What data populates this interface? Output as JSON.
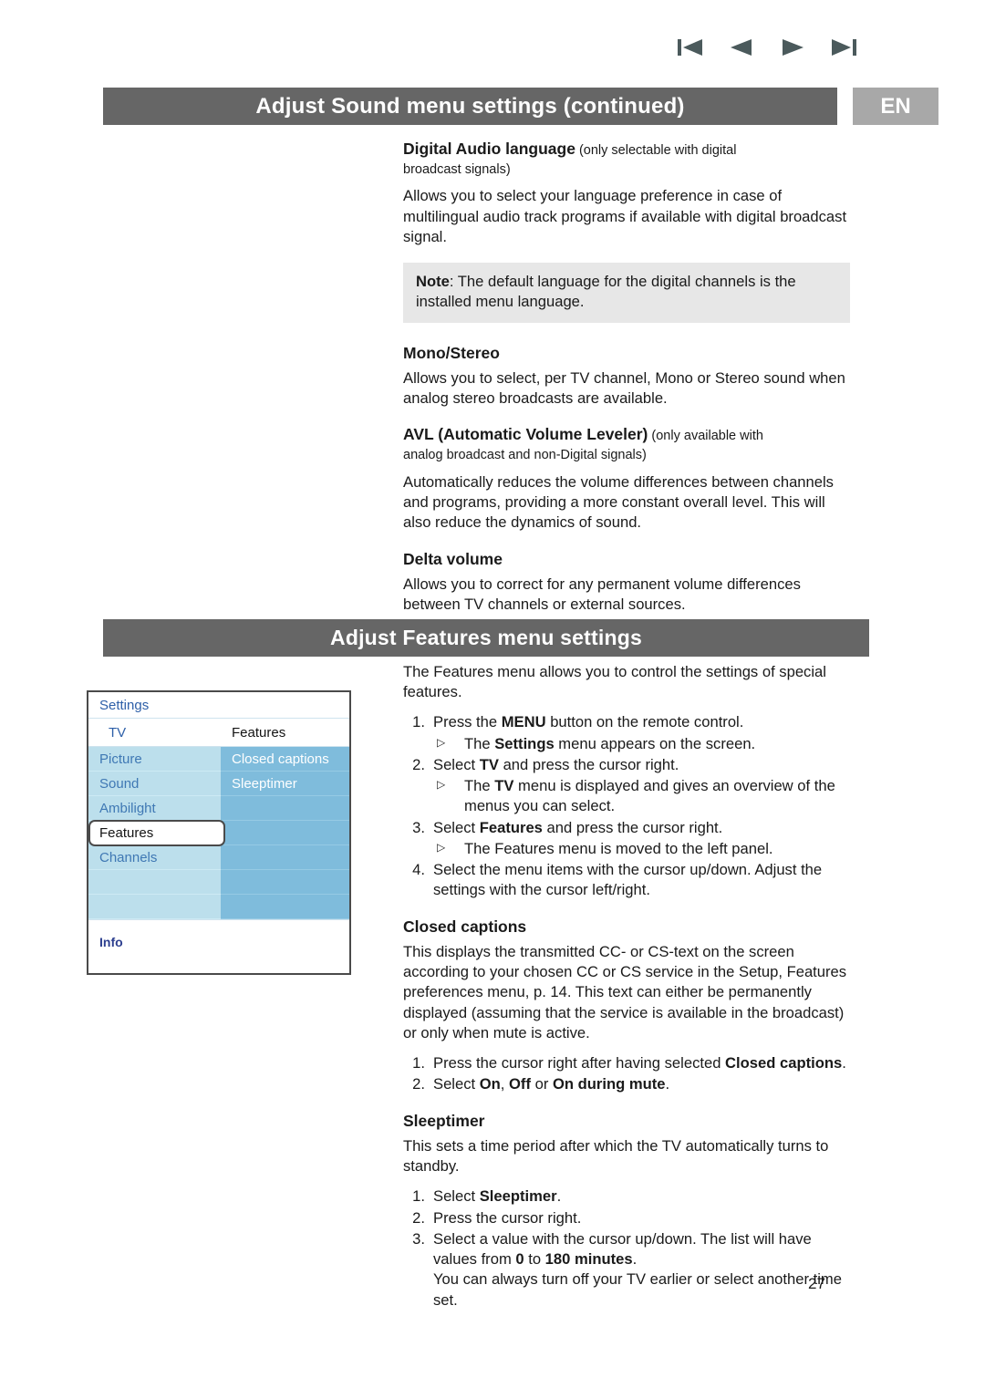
{
  "nav": {
    "first_label": "first-page",
    "prev_label": "previous-page",
    "next_label": "next-page",
    "last_label": "last-page"
  },
  "header": {
    "sound_title": "Adjust Sound menu settings  (continued)",
    "features_title": "Adjust Features menu settings",
    "language_badge": "EN",
    "bar_color": "#666666",
    "badge_color": "#a8a8a8"
  },
  "sound_section": {
    "digital_audio": {
      "heading_bold": "Digital Audio language",
      "heading_sub": " (only selectable with digital",
      "heading_sub_line2": "broadcast signals)",
      "body": "Allows you to select your language preference in case of multilingual audio track programs if available with digital broadcast signal."
    },
    "note": {
      "label": "Note",
      "text": ": The default language for the digital channels is the installed menu language.",
      "bg_color": "#e7e7e7"
    },
    "mono_stereo": {
      "heading": "Mono/Stereo",
      "body": "Allows you to select, per TV channel, Mono or Stereo sound when analog stereo broadcasts are available."
    },
    "avl": {
      "heading_bold": "AVL (Automatic Volume Leveler)",
      "heading_sub": " (only available with",
      "heading_sub_line2": "analog broadcast and non-Digital signals)",
      "body": "Automatically reduces the volume differences between channels and programs, providing a more constant overall level. This will also reduce the dynamics of sound."
    },
    "delta_volume": {
      "heading": "Delta volume",
      "body": "Allows you to correct for any permanent volume differences between TV channels or external sources."
    }
  },
  "tv_menu": {
    "title": "Settings",
    "left_header": "TV",
    "right_header": "Features",
    "left_items": [
      "Picture",
      "Sound",
      "Ambilight",
      "Features",
      "Channels"
    ],
    "selected_left_item": "Features",
    "right_items": [
      "Closed captions",
      "Sleeptimer"
    ],
    "footer": "Info",
    "left_bg_color": "#bcdfec",
    "right_bg_color": "#7fbcdc",
    "left_text_color": "#3f78b4",
    "title_color": "#2d5fa8"
  },
  "features_section": {
    "intro": "The Features menu allows you to control the settings of special features.",
    "steps": [
      {
        "num": "1.",
        "parts": [
          {
            "t": "Press the ",
            "b": false
          },
          {
            "t": "MENU",
            "b": true
          },
          {
            "t": " button on the remote control.",
            "b": false
          }
        ],
        "sub": [
          [
            {
              "t": "The ",
              "b": false
            },
            {
              "t": "Settings",
              "b": true
            },
            {
              "t": " menu appears on the screen.",
              "b": false
            }
          ]
        ]
      },
      {
        "num": "2.",
        "parts": [
          {
            "t": "Select ",
            "b": false
          },
          {
            "t": "TV",
            "b": true
          },
          {
            "t": " and press the cursor right.",
            "b": false
          }
        ],
        "sub": [
          [
            {
              "t": "The ",
              "b": false
            },
            {
              "t": "TV",
              "b": true
            },
            {
              "t": " menu is displayed and gives an overview of the menus you can select.",
              "b": false
            }
          ]
        ]
      },
      {
        "num": "3.",
        "parts": [
          {
            "t": "Select ",
            "b": false
          },
          {
            "t": "Features",
            "b": true
          },
          {
            "t": " and press the cursor right.",
            "b": false
          }
        ],
        "sub": [
          [
            {
              "t": "The Features menu is moved to the left panel.",
              "b": false
            }
          ]
        ]
      },
      {
        "num": "4.",
        "parts": [
          {
            "t": "Select the menu items with the cursor up/down. Adjust the settings with the cursor left/right.",
            "b": false
          }
        ],
        "sub": []
      }
    ],
    "closed_captions": {
      "heading": "Closed captions",
      "body": "This displays the transmitted CC- or CS-text on the screen according to your chosen CC or CS service in the Setup, Features preferences menu, p. 14. This text can either be permanently displayed (assuming that the service is available in the broadcast) or only when mute is active.",
      "steps": [
        {
          "num": "1.",
          "parts": [
            {
              "t": "Press the cursor right after having selected ",
              "b": false
            },
            {
              "t": "Closed captions",
              "b": true
            },
            {
              "t": ".",
              "b": false
            }
          ]
        },
        {
          "num": "2.",
          "parts": [
            {
              "t": "Select ",
              "b": false
            },
            {
              "t": "On",
              "b": true
            },
            {
              "t": ", ",
              "b": false
            },
            {
              "t": "Off",
              "b": true
            },
            {
              "t": " or ",
              "b": false
            },
            {
              "t": "On during mute",
              "b": true
            },
            {
              "t": ".",
              "b": false
            }
          ]
        }
      ]
    },
    "sleeptimer": {
      "heading": "Sleeptimer",
      "body": "This sets a time period after which the TV automatically turns to standby.",
      "steps": [
        {
          "num": "1.",
          "parts": [
            {
              "t": "Select ",
              "b": false
            },
            {
              "t": "Sleeptimer",
              "b": true
            },
            {
              "t": ".",
              "b": false
            }
          ]
        },
        {
          "num": "2.",
          "parts": [
            {
              "t": "Press the cursor right.",
              "b": false
            }
          ]
        },
        {
          "num": "3.",
          "parts": [
            {
              "t": "Select a value with the cursor up/down. The list will have values from ",
              "b": false
            },
            {
              "t": "0",
              "b": true
            },
            {
              "t": " to ",
              "b": false
            },
            {
              "t": "180 minutes",
              "b": true
            },
            {
              "t": ".",
              "b": false
            }
          ],
          "extra": "You can always turn off your TV earlier or select another time set."
        }
      ]
    }
  },
  "footer": {
    "page_number": "27"
  }
}
